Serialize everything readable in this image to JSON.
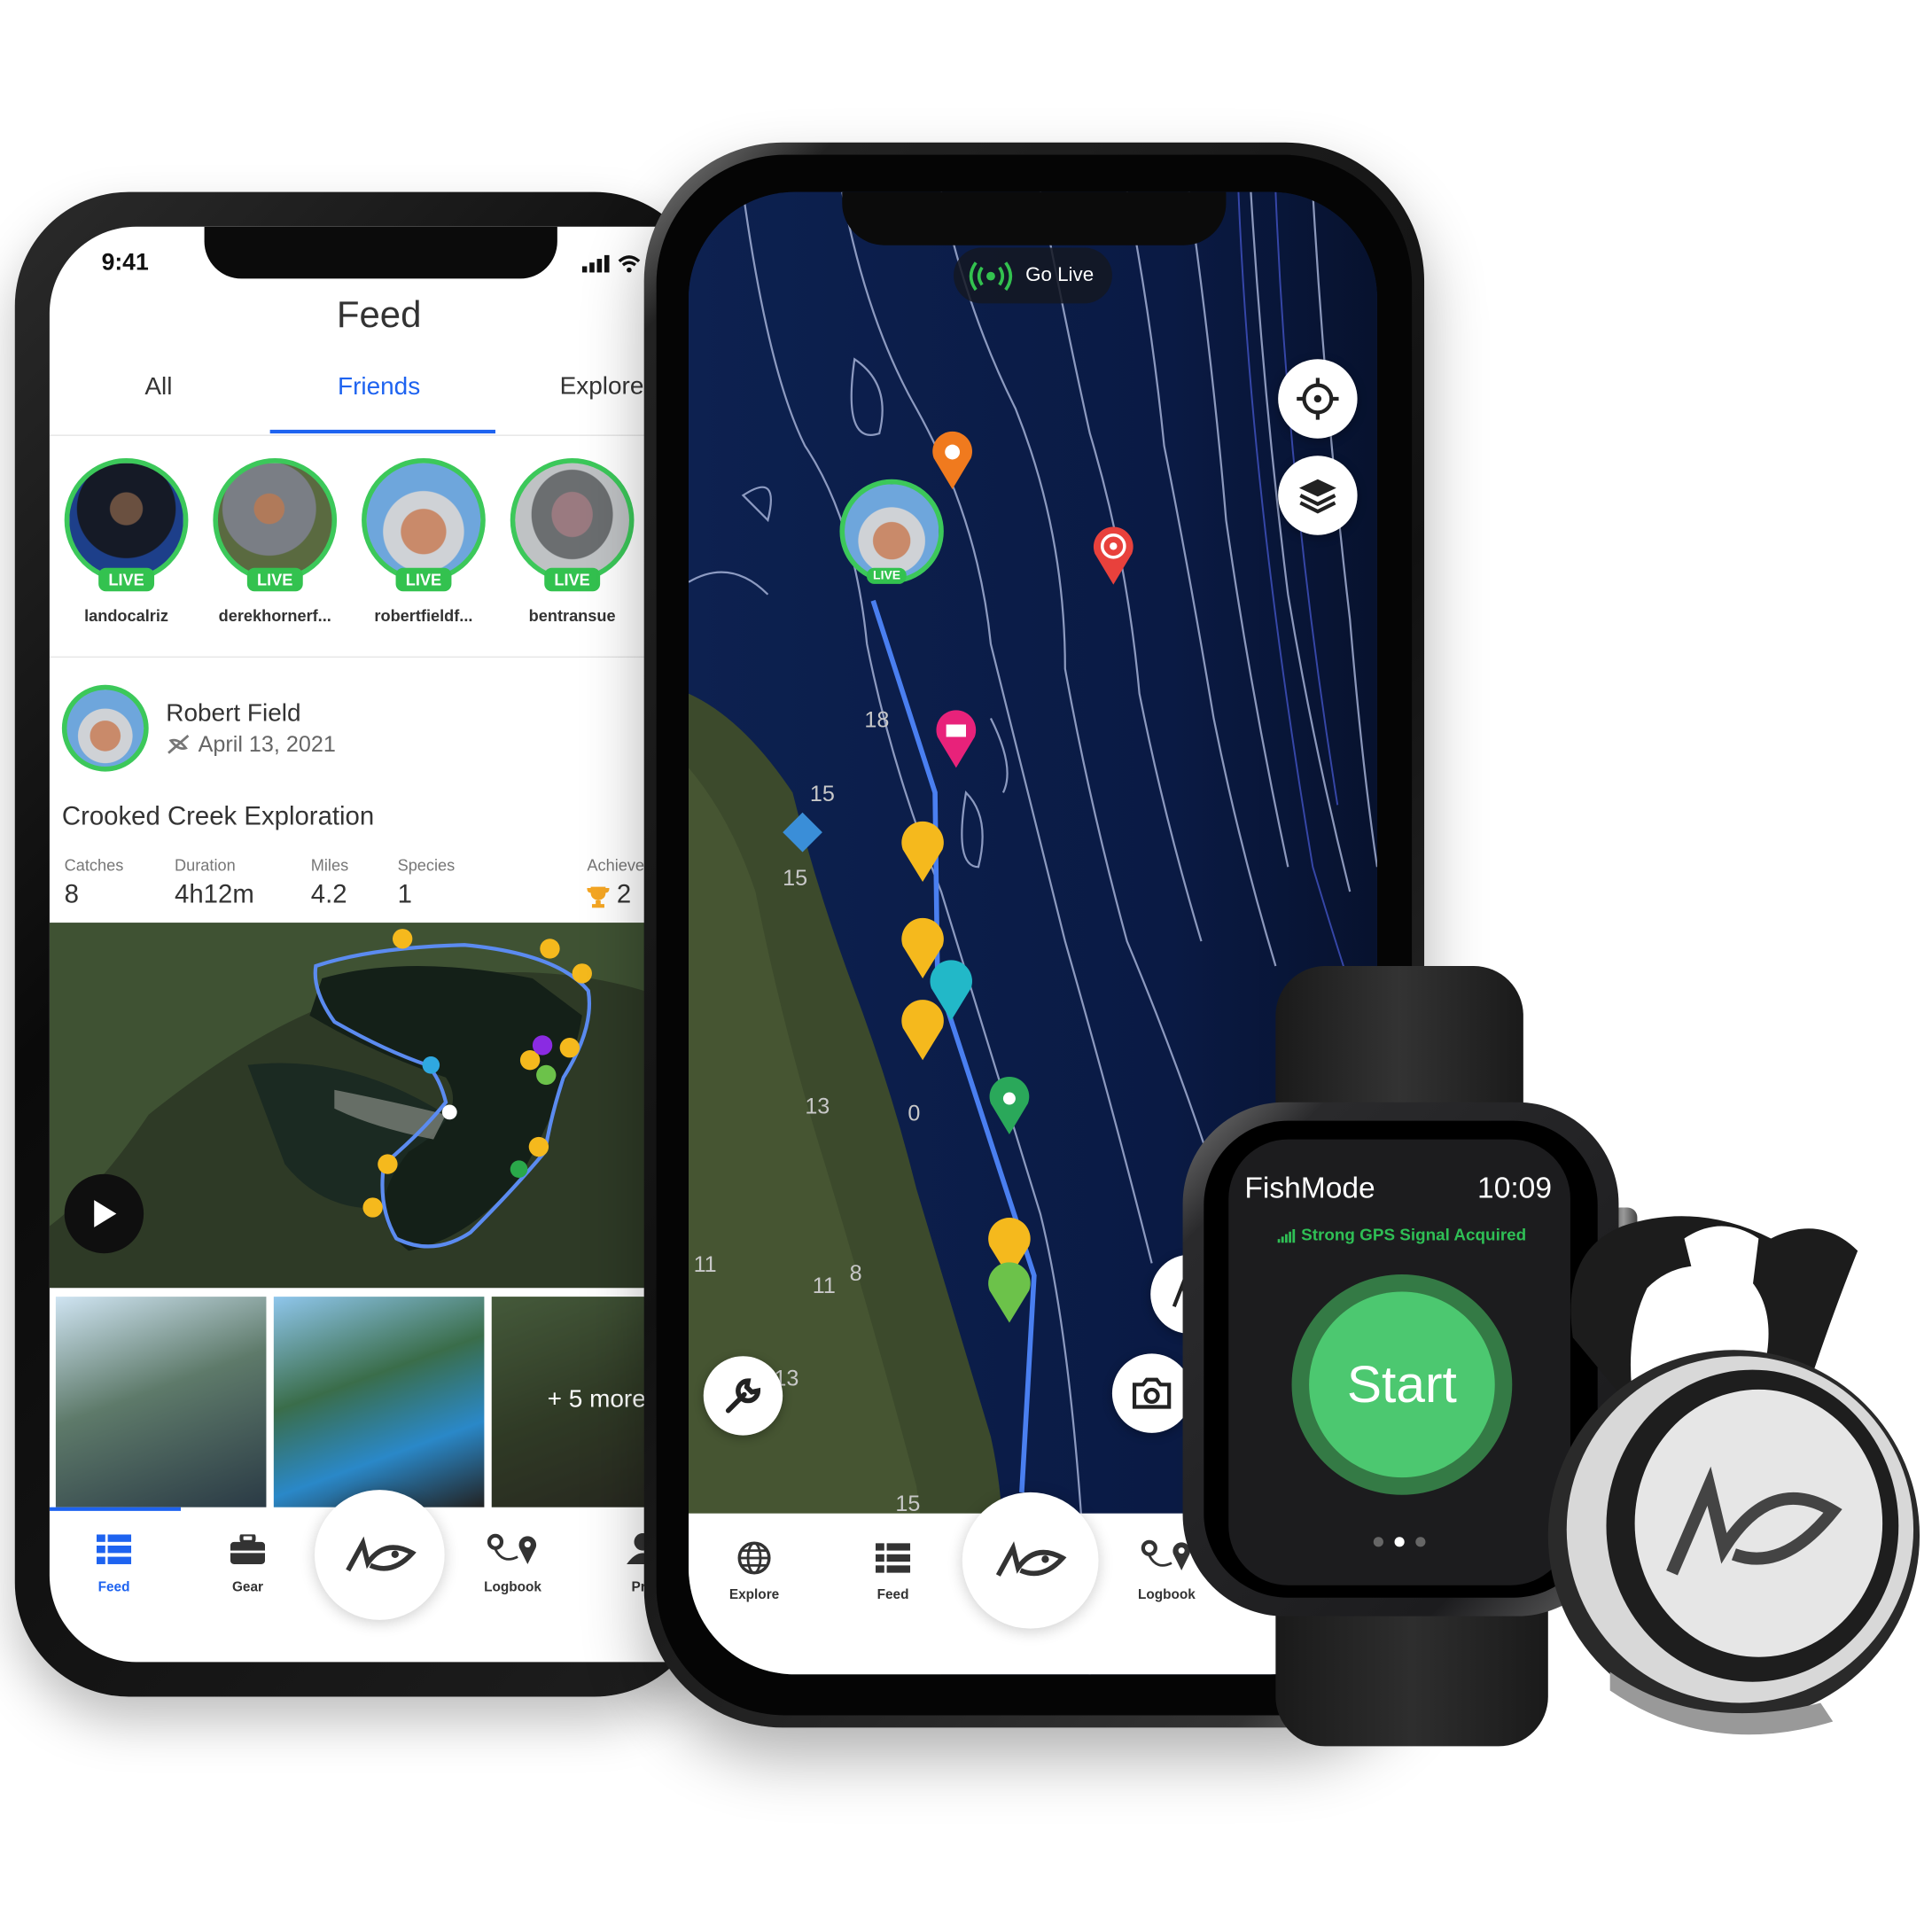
{
  "feed_phone": {
    "status_time": "9:41",
    "title": "Feed",
    "tabs": [
      {
        "label": "All"
      },
      {
        "label": "Friends",
        "active": true
      },
      {
        "label": "Explore"
      }
    ],
    "live_badge": "LIVE",
    "friends": [
      {
        "username": "landocalriz"
      },
      {
        "username": "derekhornerf..."
      },
      {
        "username": "robertfieldf..."
      },
      {
        "username": "bentransue"
      }
    ],
    "post": {
      "author": "Robert Field",
      "date": "April 13, 2021",
      "title": "Crooked Creek Exploration",
      "stats": [
        {
          "label": "Catches",
          "value": "8"
        },
        {
          "label": "Duration",
          "value": "4h12m"
        },
        {
          "label": "Miles",
          "value": "4.2"
        },
        {
          "label": "Species",
          "value": "1"
        },
        {
          "label": "Achievements",
          "value": "2"
        }
      ],
      "more_photos": "+ 5 more"
    },
    "tabbar": [
      {
        "label": "Feed",
        "active": true
      },
      {
        "label": "Gear"
      },
      {
        "label": ""
      },
      {
        "label": "Logbook"
      },
      {
        "label": "Pro"
      }
    ]
  },
  "map_phone": {
    "go_live": "Go Live",
    "depth_labels": [
      "18",
      "15",
      "15",
      "13",
      "0",
      "11",
      "8",
      "11",
      "13",
      "15"
    ],
    "tabbar": [
      {
        "label": "Explore"
      },
      {
        "label": "Feed"
      },
      {
        "label": ""
      },
      {
        "label": "Logbook"
      }
    ]
  },
  "watch": {
    "app_name": "FishMode",
    "time": "10:09",
    "gps_status": "Strong GPS Signal Acquired",
    "start_label": "Start",
    "page_index": 2,
    "page_count": 3
  },
  "colors": {
    "accent_blue": "#1e63f0",
    "live_green": "#33c24f",
    "start_green": "#4cc870",
    "map_water": "#0c1f4a",
    "route": "#4a7ff0",
    "pin_yellow": "#f5b91d"
  }
}
